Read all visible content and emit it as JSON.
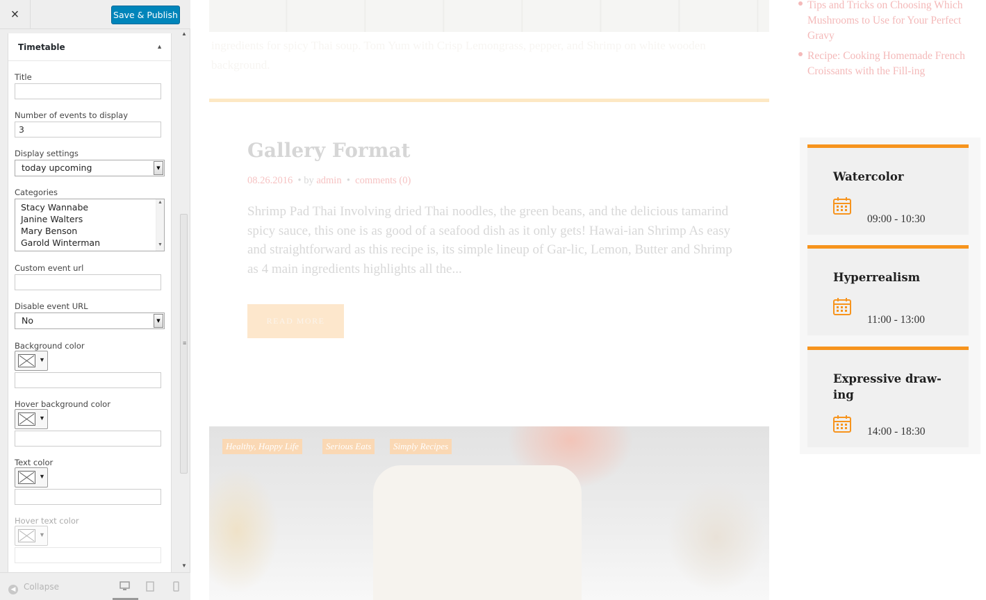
{
  "customizer": {
    "close_glyph": "×",
    "publish_label": "Save & Publish",
    "panel_title": "Timetable",
    "fields": {
      "title_label": "Title",
      "title_value": "",
      "num_events_label": "Number of events to display",
      "num_events_value": "3",
      "display_label": "Display settings",
      "display_value": "today upcoming",
      "categories_label": "Categories",
      "categories": [
        "Stacy Wannabe",
        "Janine Walters",
        "Mary Benson",
        "Garold Winterman"
      ],
      "custom_url_label": "Custom event url",
      "custom_url_value": "",
      "disable_url_label": "Disable event URL",
      "disable_url_value": "No",
      "bg_color_label": "Background color",
      "hover_bg_label": "Hover background color",
      "text_color_label": "Text color",
      "hover_text_label": "Hover text color"
    },
    "footer": {
      "collapse_label": "Collapse"
    },
    "colors": {
      "publish": "#0085ba",
      "panel_bg": "#eeeeee"
    }
  },
  "preview": {
    "top_faded_text": "ingredients for spicy Thai soup. Tom Yum with Crisp Lemongrass, pepper, and Shrimp on white wooden background.",
    "post": {
      "title": "Gallery Format",
      "date": "08.26.2016",
      "by": "by",
      "author": "admin",
      "comments": "comments (0)",
      "excerpt": "Shrimp Pad Thai Involving dried Thai noodles, the green beans, and the delicious tamarind spicy sauce, this one is as good of a seafood dish as it only gets!  Hawai-ian Shrimp As easy and straightforward as this recipe is, its simple lineup of Gar-lic, Lemon, Butter and Shrimp as 4 main ingredients highlights all the...",
      "read_more": "READ MORE"
    },
    "tags": [
      "Healthy, Happy Life",
      "Serious Eats",
      "Simply Recipes"
    ],
    "recent_posts": [
      "Tips and Tricks on Choosing Which Mushrooms to Use for Your Perfect Gravy",
      "Recipe: Cooking Homemade French Croissants with the Fill-ing"
    ],
    "events": [
      {
        "title": "Watercolor",
        "time": "09:00 - 10:30"
      },
      {
        "title": "Hyperrealism",
        "time": "11:00 - 13:00"
      },
      {
        "title": "Expressive draw-ing",
        "time": "14:00 - 18:30"
      }
    ],
    "colors": {
      "accent": "#f7941d",
      "link_pink": "#f4b9b9"
    }
  }
}
